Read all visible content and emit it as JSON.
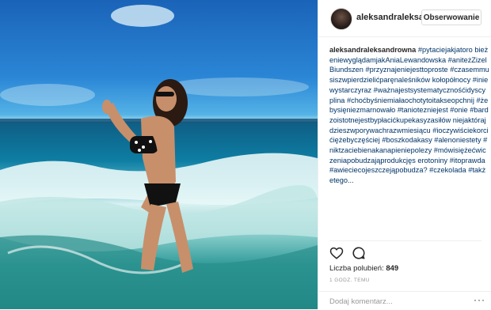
{
  "post": {
    "username": "aleksandraleksar",
    "follow_label": "Obserwowanie"
  },
  "caption": {
    "author": "aleksandraleksandrowna",
    "tags": [
      "#pytaciejakjatoro bieżeniewyglądamjakAniaLewandowska",
      "#aniteżZizelBiundszen",
      "#przyznajeniejesttoproste",
      "#czasemmusiszwpierdzielićparęnaleśników kołopółnocy",
      "#iniewystarczyraz",
      "#ważnajestsystematycznośćidyscyplina",
      "#choćbyśniemiałaochotytoitakseopchnij",
      "#żebysięniezmarnowało",
      "#taniotezniejest",
      "#onie",
      "#bardzoistotnejestbypłacićkupekasyzasiłów niejaktórajdzieszwporywachrazwmiesiącu",
      "#ioczywiściekorcićiężebyczęściej",
      "#boszkodakasy",
      "#alenoniestety",
      "#niktzaciebienakanapieniepolezy",
      "#mówisiężećwiczeniapobudzająprodukcjęs erotoniny",
      "#itoprawda",
      "#awieciecojeszczejąpobudza?",
      "#czekolada",
      "#takżetego..."
    ]
  },
  "actions": {
    "like_icon": "heart-outline-icon",
    "comment_icon": "speech-bubble-icon"
  },
  "stats": {
    "likes_label": "Liczba polubień:",
    "likes_count": "849",
    "time": "1 GODZ. TEMU"
  },
  "comment": {
    "placeholder": "Dodaj komentarz...",
    "more_label": "···"
  },
  "colors": {
    "hashtag": "#003569",
    "text": "#262626",
    "muted": "#999999",
    "border": "#efefef"
  }
}
